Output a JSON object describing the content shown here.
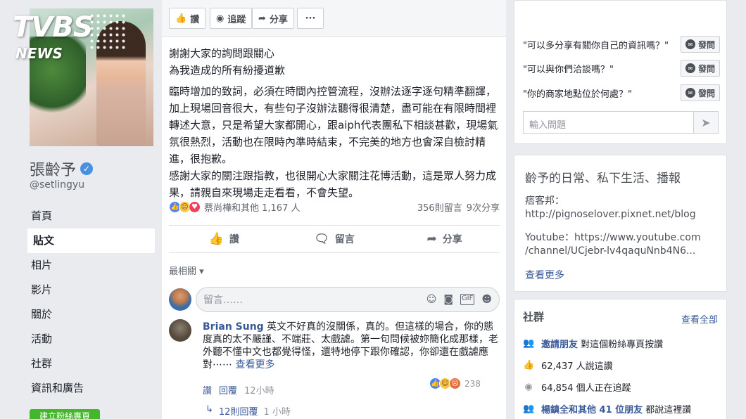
{
  "watermark": {
    "line1": "TVBS",
    "line2": "NEWS"
  },
  "page": {
    "name": "張齡予",
    "handle": "@setlingyu"
  },
  "nav": [
    "首頁",
    "貼文",
    "相片",
    "影片",
    "關於",
    "活動",
    "社群",
    "資訊和廣告"
  ],
  "nav_active_index": 1,
  "create_page_label": "建立粉絲專頁",
  "topbar": {
    "like": "讚",
    "follow": "追蹤",
    "share": "分享",
    "more": "···"
  },
  "post": {
    "lines": [
      "謝謝大家的詢問跟關心",
      "為我造成的所有紛擾道歉",
      "臨時增加的致詞，必須在時間內控管流程，沒辦法逐字逐句精準翻譯，加上現場回音很大，有些句子沒辦法聽得很清楚，盡可能在有限時間裡轉述大意，只是希望大家都開心，跟aiph代表團私下相談甚歡，現場氣氛很熱烈，活動也在限時內準時結束，不完美的地方也會深自檢討精進，很抱歉。",
      "感謝大家的關注跟指教，也很開心大家關注花博活動，這是眾人努力成果，請親自來現場走走看看，不會失望。"
    ],
    "reactions_text": "蔡尚樺和其他 1,167 人",
    "comments_count": "356則留言",
    "shares_count": "9次分享"
  },
  "actions": {
    "like": "讚",
    "comment": "留言",
    "share": "分享"
  },
  "sort_label": "最相關 ▾",
  "comment_input_placeholder": "留言……",
  "comment": {
    "author": "Brian Sung",
    "text": "英文不好真的沒關係，真的。但這樣的場合，你的態度真的太不嚴謹、不端莊、太戲謔。第一句問候被妳簡化成那樣，老外聽不懂中文也都覺得怪，還特地停下跟你確認，你卻還在戲謔應對⋯⋯",
    "see_more": "查看更多",
    "like": "讚",
    "reply": "回覆",
    "time": "12小時",
    "reaction_count": "238",
    "replies_label": "12則回覆",
    "replies_time": "1 小時"
  },
  "questions": {
    "items": [
      "\"可以多分享有關你自己的資訊嗎？\"",
      "\"可以與你們洽談嗎？\"",
      "\"你的商家地點位於何處？\""
    ],
    "ask_label": "發問",
    "input_placeholder": "輸入問題"
  },
  "about": {
    "title": "齡予的日常、私下生活、播報",
    "blog_label": "痞客邦：",
    "blog_url": "http://pignoselover.pixnet.net/blog",
    "youtube_line1": "Youtube：https://www.youtube.com",
    "youtube_line2": "/channel/UCjebr-lv4qaquNnb4N6...",
    "more": "查看更多"
  },
  "community": {
    "title": "社群",
    "see_all": "查看全部",
    "invite_link": "邀請朋友",
    "invite_text": "對這個粉絲專頁按讚",
    "likes": "62,437 人說這讚",
    "follows": "64,854 個人正在追蹤",
    "friends_link": "楊鎮全和其他 41 位朋友",
    "friends_text": "都說這裡讚"
  }
}
